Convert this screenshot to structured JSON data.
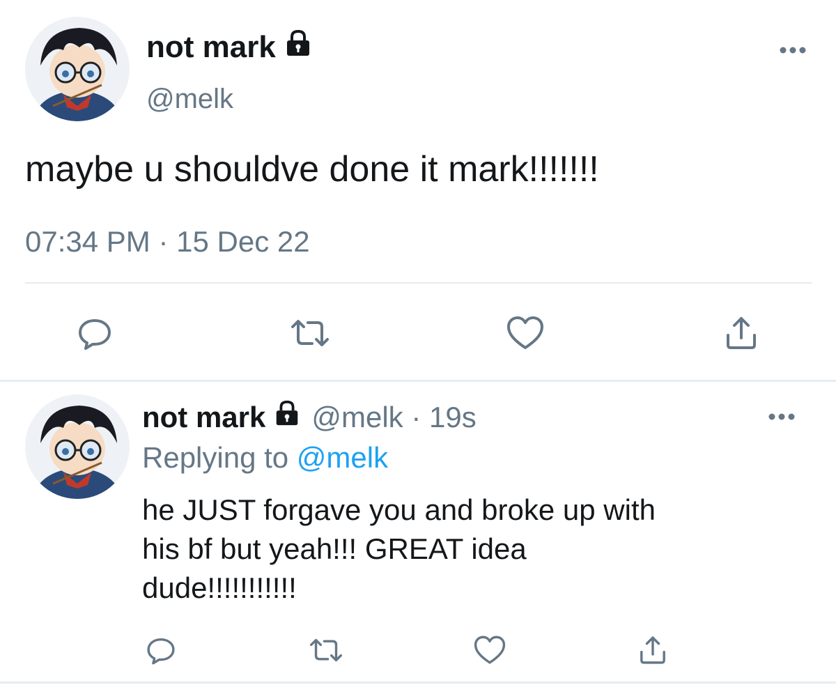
{
  "main_tweet": {
    "display_name": "not mark",
    "handle": "@melk",
    "text": "maybe u shouldve done it mark!!!!!!!",
    "time": "07:34 PM",
    "separator": "·",
    "date": "15 Dec 22",
    "icons": {
      "lock": "lock-icon",
      "more": "more-icon",
      "reply": "reply-icon",
      "retweet": "retweet-icon",
      "like": "heart-icon",
      "share": "share-icon"
    }
  },
  "reply_tweet": {
    "display_name": "not mark",
    "handle_time": "@melk · 19s",
    "replying_prefix": "Replying to",
    "replying_mention": "@melk",
    "text": "he JUST forgave you and broke up with\nhis bf but yeah!!! GREAT idea\ndude!!!!!!!!!!!"
  },
  "colors": {
    "text": "#14171a",
    "secondary": "#657786",
    "link": "#1da1f2",
    "divider": "#e6ecf0"
  }
}
